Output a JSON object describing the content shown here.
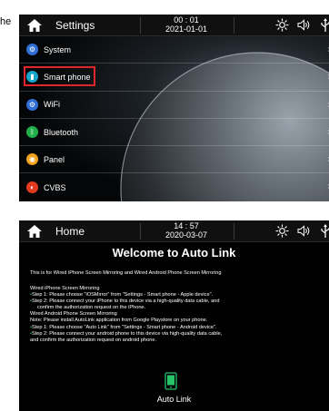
{
  "edge_text": "he",
  "settings": {
    "title": "Settings",
    "time": "00 : 01",
    "date": "2021-01-01",
    "items": [
      {
        "label": "System",
        "color": "#2f6fd6"
      },
      {
        "label": "Smart phone",
        "color": "#17a6c9",
        "selected": true
      },
      {
        "label": "WiFi",
        "color": "#2f6fd6"
      },
      {
        "label": "Bluetooth",
        "color": "#1fae4a"
      },
      {
        "label": "Panel",
        "color": "#f0a21a"
      },
      {
        "label": "CVBS",
        "color": "#e23a1e"
      }
    ]
  },
  "autolink": {
    "title": "Home",
    "time": "14 : 57",
    "date": "2020-03-07",
    "heading": "Welcome to Auto Link",
    "intro": "This is for Wired iPhone Screen Mirroring and Wired Android Phone Screen Mirroring",
    "lines": [
      {
        "text": "Wired iPhone Screen Mirroring",
        "bullet": false,
        "indent": false
      },
      {
        "text": "Step 1: Please choose \"iOSMirror\" from \"Settings - Smart phone - Apple device\".",
        "bullet": true,
        "indent": false
      },
      {
        "text": "Step 2: Please connect your iPhone to this device via a high-quality data cable, and",
        "bullet": true,
        "indent": false
      },
      {
        "text": "confirm the authorization request on the iPhone.",
        "bullet": false,
        "indent": true
      },
      {
        "text": "Wired Android Phone Screen Mirroring",
        "bullet": false,
        "indent": false
      },
      {
        "text": "Note: Please install AutoLink application from Google Playstore on your phone.",
        "bullet": false,
        "indent": false
      },
      {
        "text": "Step 1: Please choose \"Auto Link\" from \"Settings - Smart phone - Android device\".",
        "bullet": true,
        "indent": false
      },
      {
        "text": "Step 2: Please connect your android phone to this device via high-quality data cable,",
        "bullet": true,
        "indent": false
      },
      {
        "text": "and confirm the authorization request on android phone.",
        "bullet": false,
        "indent": false
      }
    ],
    "app_label": "Auto Link",
    "app_icon": "phone-link-icon"
  },
  "icons": {
    "home": "home-icon",
    "brightness": "brightness-icon",
    "volume": "volume-icon",
    "usb": "usb-icon",
    "chevron": "chevron-right-icon"
  }
}
